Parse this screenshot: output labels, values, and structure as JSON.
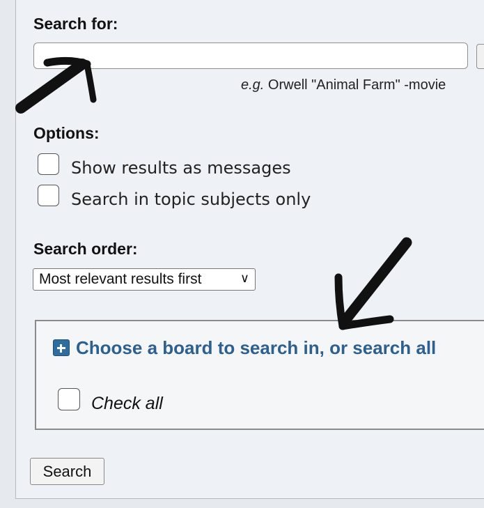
{
  "search": {
    "label": "Search for:",
    "value": "",
    "example_prefix": "e.g.",
    "example_text": " Orwell \"Animal Farm\" -movie"
  },
  "options": {
    "label": "Options:",
    "items": [
      {
        "label": "Show results as messages",
        "checked": false
      },
      {
        "label": "Search in topic subjects only",
        "checked": false
      }
    ]
  },
  "order": {
    "label": "Search order:",
    "selected": "Most relevant results first"
  },
  "boards": {
    "link_label": "Choose a board to search in, or search all",
    "check_all_label": "Check all",
    "icon": "plus-square-icon"
  },
  "actions": {
    "search_button": "Search"
  },
  "colors": {
    "link": "#2d5f8f",
    "panel": "#eef1f5",
    "annotation": "#111111"
  }
}
